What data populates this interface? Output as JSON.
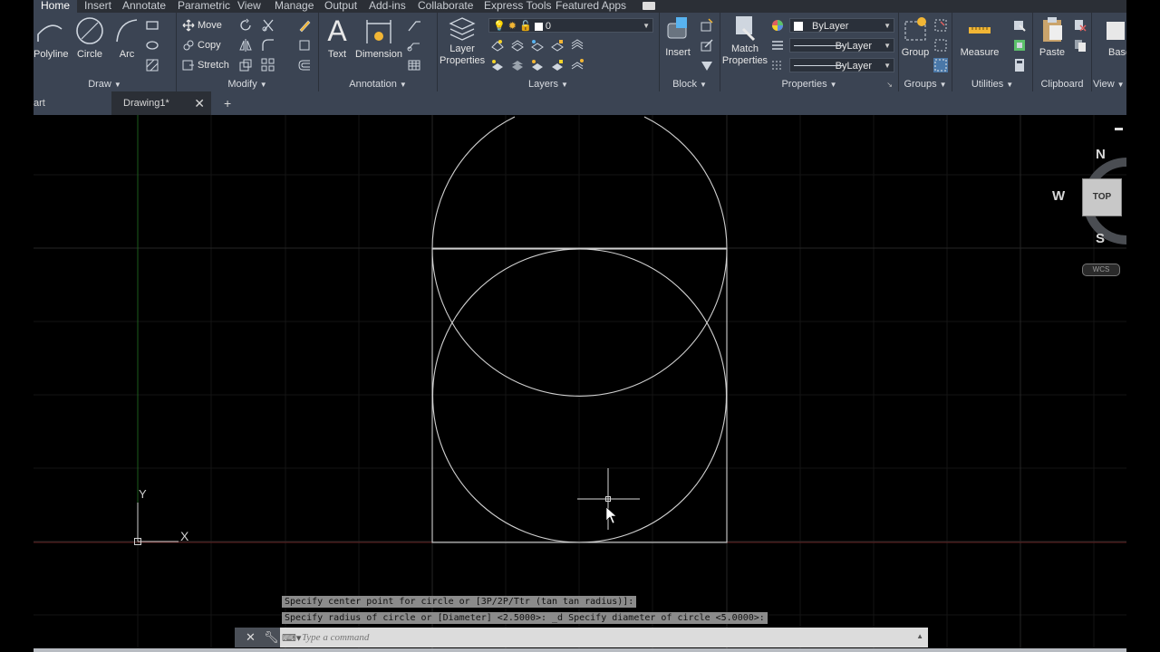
{
  "ribbon_tabs": [
    "Home",
    "Insert",
    "Annotate",
    "Parametric",
    "View",
    "Manage",
    "Output",
    "Add-ins",
    "Collaborate",
    "Express Tools",
    "Featured Apps"
  ],
  "draw_panel": {
    "title": "Draw",
    "polyline": "Polyline",
    "circle": "Circle",
    "arc": "Arc"
  },
  "modify_panel": {
    "title": "Modify",
    "move": "Move",
    "copy": "Copy",
    "stretch": "Stretch"
  },
  "annotation_panel": {
    "title": "Annotation",
    "text": "Text",
    "dimension": "Dimension"
  },
  "layers_panel": {
    "title": "Layers",
    "layer_properties_1": "Layer",
    "layer_properties_2": "Properties",
    "current_layer": "0"
  },
  "block_panel": {
    "title": "Block",
    "insert": "Insert"
  },
  "properties_panel": {
    "title": "Properties",
    "match_1": "Match",
    "match_2": "Properties",
    "color": "ByLayer",
    "linetype": "ByLayer",
    "lineweight": "ByLayer"
  },
  "groups_panel": {
    "title": "Groups",
    "group": "Group"
  },
  "utilities_panel": {
    "title": "Utilities",
    "measure": "Measure"
  },
  "clipboard_panel": {
    "title": "Clipboard",
    "paste": "Paste"
  },
  "view_panel": {
    "title": "View",
    "base": "Base"
  },
  "doc_tabs": {
    "start": "art",
    "drawing": "Drawing1*",
    "add": "+"
  },
  "viewcube": {
    "north": "N",
    "west": "W",
    "south": "S",
    "face": "TOP",
    "wcs": "WCS"
  },
  "ucs": {
    "x": "X",
    "y": "Y"
  },
  "command": {
    "history_1": "Specify center point for circle or [3P/2P/Ttr (tan tan radius)]:",
    "history_2": "Specify radius of circle or [Diameter] <2.5000>: _d Specify diameter of circle <5.0000>:",
    "placeholder": "Type a command"
  }
}
